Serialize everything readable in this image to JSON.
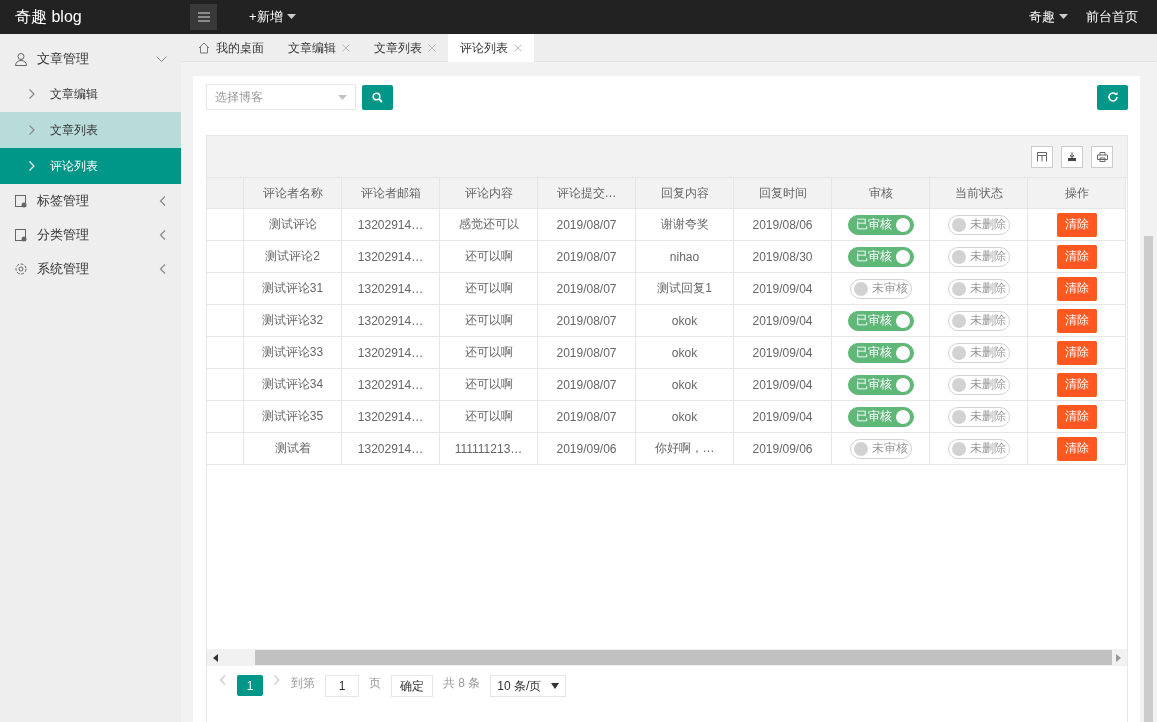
{
  "header": {
    "logo": "奇趣 blog",
    "add_menu": "+新增",
    "user_menu": "奇趣",
    "home_link": "前台首页"
  },
  "sidebar": {
    "items": [
      {
        "label": "文章管理",
        "kind": "user",
        "expanded": true,
        "children": [
          {
            "label": "文章编辑",
            "selected": false,
            "highlighted": false
          },
          {
            "label": "文章列表",
            "selected": false,
            "highlighted": true
          },
          {
            "label": "评论列表",
            "selected": true,
            "highlighted": false
          }
        ]
      },
      {
        "label": "标签管理",
        "kind": "doc",
        "expanded": false
      },
      {
        "label": "分类管理",
        "kind": "doc",
        "expanded": false
      },
      {
        "label": "系统管理",
        "kind": "gear",
        "expanded": false
      }
    ]
  },
  "tabs": [
    {
      "label": "我的桌面",
      "kind": "home",
      "selected": false
    },
    {
      "label": "文章编辑",
      "kind": "page",
      "selected": false
    },
    {
      "label": "文章列表",
      "kind": "page",
      "selected": false
    },
    {
      "label": "评论列表",
      "kind": "page",
      "selected": true
    }
  ],
  "search": {
    "placeholder": "选择博客"
  },
  "table": {
    "columns": [
      "评论者名称",
      "评论者邮箱",
      "评论内容",
      "评论提交…",
      "回复内容",
      "回复时间",
      "审核",
      "当前状态",
      "操作"
    ],
    "rows": [
      {
        "name": "测试评论",
        "email": "13202914…",
        "content": "感觉还可以",
        "submitted": "2019/08/07",
        "reply": "谢谢夸奖",
        "reply_time": "2019/08/06",
        "audit": {
          "on": true,
          "label": "已审核"
        },
        "state": {
          "on": false,
          "label": "未删除"
        },
        "action": "清除"
      },
      {
        "name": "测试评论2",
        "email": "13202914…",
        "content": "还可以啊",
        "submitted": "2019/08/07",
        "reply": "nihao",
        "reply_time": "2019/08/30",
        "audit": {
          "on": true,
          "label": "已审核"
        },
        "state": {
          "on": false,
          "label": "未删除"
        },
        "action": "清除"
      },
      {
        "name": "测试评论31",
        "email": "13202914…",
        "content": "还可以啊",
        "submitted": "2019/08/07",
        "reply": "测试回复1",
        "reply_time": "2019/09/04",
        "audit": {
          "on": false,
          "label": "未审核"
        },
        "state": {
          "on": false,
          "label": "未删除"
        },
        "action": "清除"
      },
      {
        "name": "测试评论32",
        "email": "13202914…",
        "content": "还可以啊",
        "submitted": "2019/08/07",
        "reply": "okok",
        "reply_time": "2019/09/04",
        "audit": {
          "on": true,
          "label": "已审核"
        },
        "state": {
          "on": false,
          "label": "未删除"
        },
        "action": "清除"
      },
      {
        "name": "测试评论33",
        "email": "13202914…",
        "content": "还可以啊",
        "submitted": "2019/08/07",
        "reply": "okok",
        "reply_time": "2019/09/04",
        "audit": {
          "on": true,
          "label": "已审核"
        },
        "state": {
          "on": false,
          "label": "未删除"
        },
        "action": "清除"
      },
      {
        "name": "测试评论34",
        "email": "13202914…",
        "content": "还可以啊",
        "submitted": "2019/08/07",
        "reply": "okok",
        "reply_time": "2019/09/04",
        "audit": {
          "on": true,
          "label": "已审核"
        },
        "state": {
          "on": false,
          "label": "未删除"
        },
        "action": "清除"
      },
      {
        "name": "测试评论35",
        "email": "13202914…",
        "content": "还可以啊",
        "submitted": "2019/08/07",
        "reply": "okok",
        "reply_time": "2019/09/04",
        "audit": {
          "on": true,
          "label": "已审核"
        },
        "state": {
          "on": false,
          "label": "未删除"
        },
        "action": "清除"
      },
      {
        "name": "测试着",
        "email": "13202914…",
        "content": "111111213…",
        "submitted": "2019/09/06",
        "reply": "你好啊，…",
        "reply_time": "2019/09/06",
        "audit": {
          "on": false,
          "label": "未审核"
        },
        "state": {
          "on": false,
          "label": "未删除"
        },
        "action": "清除"
      }
    ]
  },
  "pagination": {
    "pages": [
      {
        "label": "1",
        "selected": true
      }
    ],
    "goto_label": "到第",
    "page_input": "1",
    "page_unit": "页",
    "confirm": "确定",
    "total": "共 8 条",
    "page_size": "10 条/页"
  }
}
